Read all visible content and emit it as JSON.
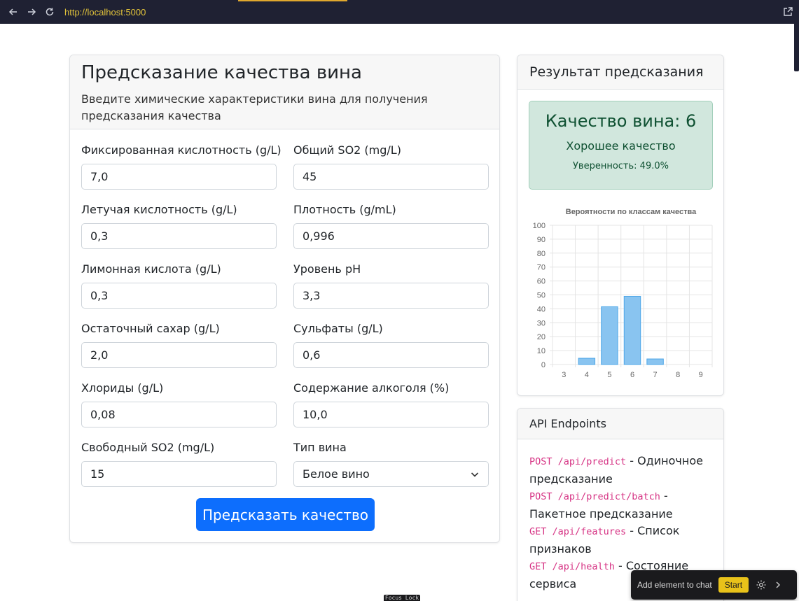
{
  "browser": {
    "url": "http://localhost:5000",
    "back_icon": "arrow-left-icon",
    "forward_icon": "arrow-right-icon",
    "reload_icon": "reload-icon",
    "open_icon": "external-link-icon"
  },
  "form": {
    "title": "Предсказание качества вина",
    "subtitle": "Введите химические характеристики вина для получения предсказания качества",
    "fields": [
      {
        "label": "Фиксированная кислотность (g/L)",
        "value": "7,0"
      },
      {
        "label": "Общий SO2 (mg/L)",
        "value": "45"
      },
      {
        "label": "Летучая кислотность (g/L)",
        "value": "0,3"
      },
      {
        "label": "Плотность (g/mL)",
        "value": "0,996"
      },
      {
        "label": "Лимонная кислота (g/L)",
        "value": "0,3"
      },
      {
        "label": "Уровень pH",
        "value": "3,3"
      },
      {
        "label": "Остаточный сахар (g/L)",
        "value": "2,0"
      },
      {
        "label": "Сульфаты (g/L)",
        "value": "0,6"
      },
      {
        "label": "Хлориды (g/L)",
        "value": "0,08"
      },
      {
        "label": "Содержание алкоголя (%)",
        "value": "10,0"
      },
      {
        "label": "Свободный SO2 (mg/L)",
        "value": "15"
      },
      {
        "label": "Тип вина",
        "value": "Белое вино"
      }
    ],
    "submit_label": "Предсказать качество",
    "accent": "#0d6efd"
  },
  "result": {
    "header": "Результат предсказания",
    "quality_title": "Качество вина: 6",
    "quality_desc": "Хорошее качество",
    "confidence": "Уверенность: 49.0%",
    "success_bg": "#d1e7dd",
    "success_text": "#0f5132"
  },
  "chart_data": {
    "type": "bar",
    "title": "Вероятности по классам качества",
    "categories": [
      "3",
      "4",
      "5",
      "6",
      "7",
      "8",
      "9"
    ],
    "values": [
      0,
      4.5,
      41.5,
      49,
      4,
      0,
      0
    ],
    "ylim": [
      0,
      100
    ],
    "yticks": [
      "0",
      "10",
      "20",
      "30",
      "40",
      "50",
      "60",
      "70",
      "80",
      "90",
      "100"
    ],
    "bar_color": "#89c4f0",
    "bar_border": "#4ea7e8",
    "grid": true
  },
  "api": {
    "header": "API Endpoints",
    "items": [
      {
        "code": "POST /api/predict",
        "desc": " - Одиночное предсказание"
      },
      {
        "code": "POST /api/predict/batch",
        "desc": " - Пакетное предсказание"
      },
      {
        "code": "GET /api/features",
        "desc": " - Список признаков"
      },
      {
        "code": "GET /api/health",
        "desc": " - Состояние сервиса"
      }
    ]
  },
  "floatbar": {
    "label": "Add element to chat",
    "start": "Start",
    "gear_icon": "gear-icon",
    "chevron_icon": "chevron-right-icon"
  },
  "focus_lock": "Focus Lock"
}
